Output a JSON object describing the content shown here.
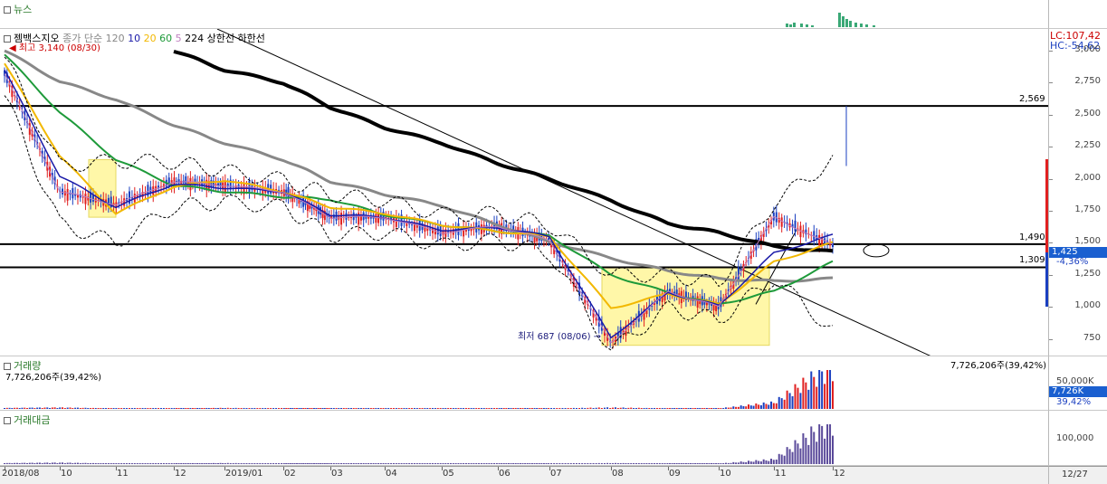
{
  "news_pane": {
    "title": "뉴스"
  },
  "price_pane": {
    "stock_name": "젬백스지오",
    "legend": {
      "prefix": "종가 단순",
      "ma_items": [
        {
          "label": "120",
          "color": "#888888"
        },
        {
          "label": "10",
          "color": "#1a1aa8"
        },
        {
          "label": "20",
          "color": "#f2b800"
        },
        {
          "label": "60",
          "color": "#1e9a3a"
        },
        {
          "label": "5",
          "color": "#c080c0"
        },
        {
          "label": "224",
          "color": "#000000"
        },
        {
          "label": "상한선",
          "color": "#000000"
        },
        {
          "label": "하한선",
          "color": "#000000"
        }
      ]
    },
    "high_note": "최고 3,140 (08/30)",
    "low_note": "최저 687 (08/06)",
    "lc": "LC:107,42",
    "hc": "HC:-54,62",
    "current_price": "1,425",
    "change_pct": "-4,36%",
    "support_labels": {
      "l2569": "2,569",
      "l1490": "1,490",
      "l1309": "1,309"
    }
  },
  "volume_pane": {
    "title": "거래량",
    "summary": "7,726,206주(39,42%)",
    "summary_right": "7,726,206주(39,42%)",
    "axis_label": "50,000K",
    "current_box": "7,726K",
    "current_pct": "39,42%"
  },
  "amount_pane": {
    "title": "거래대금",
    "axis_label": "100,000"
  },
  "date_axis": {
    "labels": [
      "2018/08",
      "10",
      "11",
      "12",
      "2019/01",
      "02",
      "03",
      "04",
      "05",
      "06",
      "07",
      "08",
      "09",
      "10",
      "11",
      "12"
    ],
    "right_label": "12/27"
  },
  "colors": {
    "up": "#e02020",
    "down": "#1a3fc0",
    "accent_green": "#2a7a2a"
  },
  "chart_data": {
    "type": "line",
    "x": [
      "2018/08",
      "2018/10",
      "2018/11",
      "2018/12",
      "2019/01",
      "2019/02",
      "2019/03",
      "2019/04",
      "2019/05",
      "2019/06",
      "2019/07",
      "2019/08",
      "2019/09",
      "2019/10",
      "2019/11",
      "2019/12"
    ],
    "series": [
      {
        "name": "224",
        "values": [
          null,
          null,
          null,
          3000,
          2850,
          2750,
          2560,
          2400,
          2280,
          2120,
          2000,
          1830,
          1650,
          1580,
          1470,
          1430
        ]
      },
      {
        "name": "120",
        "values": [
          3000,
          2760,
          2620,
          2420,
          2280,
          2150,
          1980,
          1880,
          1790,
          1640,
          1510,
          1380,
          1280,
          1220,
          1200,
          1220
        ]
      },
      {
        "name": "60",
        "values": [
          2970,
          2520,
          2150,
          1950,
          1900,
          1860,
          1840,
          1720,
          1640,
          1590,
          1560,
          1250,
          1110,
          1020,
          1120,
          1350
        ]
      },
      {
        "name": "20",
        "values": [
          2900,
          2180,
          1730,
          1940,
          1990,
          1900,
          1780,
          1730,
          1640,
          1590,
          1550,
          990,
          1100,
          1020,
          1350,
          1500
        ]
      },
      {
        "name": "10",
        "values": [
          2850,
          2020,
          1780,
          1960,
          1930,
          1900,
          1720,
          1700,
          1600,
          1620,
          1550,
          760,
          1110,
          1010,
          1420,
          1560
        ]
      },
      {
        "name": "5",
        "values": [
          2820,
          1900,
          1800,
          1980,
          1950,
          1900,
          1700,
          1700,
          1580,
          1630,
          1520,
          720,
          1120,
          1000,
          1700,
          1480
        ]
      },
      {
        "name": "상한선",
        "values": [
          2950,
          2100,
          2140,
          2130,
          2060,
          1990,
          1880,
          1830,
          1720,
          1730,
          1640,
          1250,
          1250,
          1180,
          1810,
          2150
        ]
      },
      {
        "name": "하한선",
        "values": [
          2650,
          1650,
          1500,
          1780,
          1820,
          1780,
          1560,
          1580,
          1480,
          1520,
          1420,
          660,
          990,
          900,
          1220,
          820
        ]
      }
    ],
    "horizontal_lines": [
      2569,
      1490,
      1309
    ],
    "high": {
      "value": 3140,
      "date": "08/30"
    },
    "low": {
      "value": 687,
      "date": "08/06"
    },
    "last_price": 1425,
    "change_pct": -4.36,
    "ylim": [
      620,
      3170
    ],
    "y_ticks": [
      3000,
      2750,
      2500,
      2250,
      2000,
      1750,
      1500,
      1250,
      1000,
      750
    ],
    "y_tick_labels": [
      "3,000",
      "2,750",
      "2,500",
      "2,250",
      "2,000",
      "1,750",
      "1,500",
      "1,250",
      "1,000",
      "750"
    ],
    "highlight_boxes": [
      {
        "x_from": "2018/10",
        "x_to": "2018/11",
        "y_from": 1700,
        "y_to": 2150
      },
      {
        "x_from": "2019/08",
        "x_to": "2019/10",
        "y_from": 700,
        "y_to": 1310
      }
    ],
    "volume_relative": [
      2,
      3,
      1,
      1,
      2,
      1,
      1,
      1,
      1,
      1,
      1,
      3,
      1,
      1,
      14,
      100
    ],
    "amount_relative": [
      2,
      3,
      1,
      1,
      2,
      1,
      1,
      1,
      1,
      1,
      1,
      2,
      1,
      1,
      10,
      100
    ]
  }
}
